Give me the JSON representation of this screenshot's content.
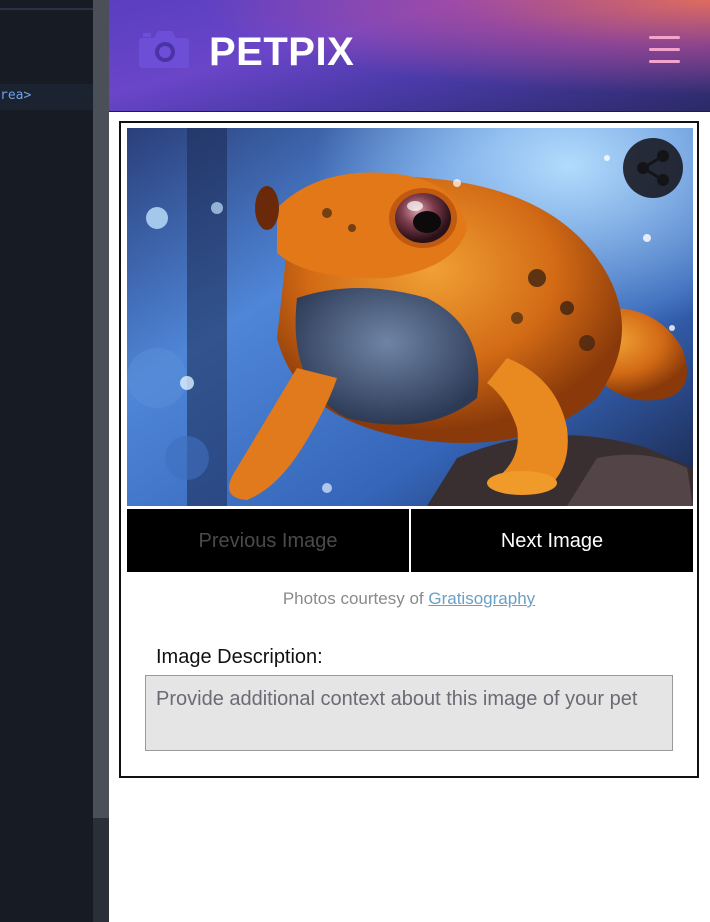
{
  "editor": {
    "code_line": "rea>"
  },
  "header": {
    "brand": "PETPIX",
    "logo_icon": "camera-icon",
    "menu_icon": "hamburger-menu-icon",
    "colors": {
      "gradient_start": "#5a3fc0",
      "gradient_end": "#2b2a66",
      "accent": "#f2a4ce"
    }
  },
  "gallery": {
    "share_icon": "share-icon",
    "prev_label": "Previous Image",
    "next_label": "Next Image",
    "prev_enabled": false
  },
  "credit": {
    "prefix": "Photos courtesy of",
    "link_text": "Gratisography"
  },
  "description": {
    "label": "Image Description:",
    "placeholder": "Provide additional context about this image of your pet",
    "value": ""
  }
}
